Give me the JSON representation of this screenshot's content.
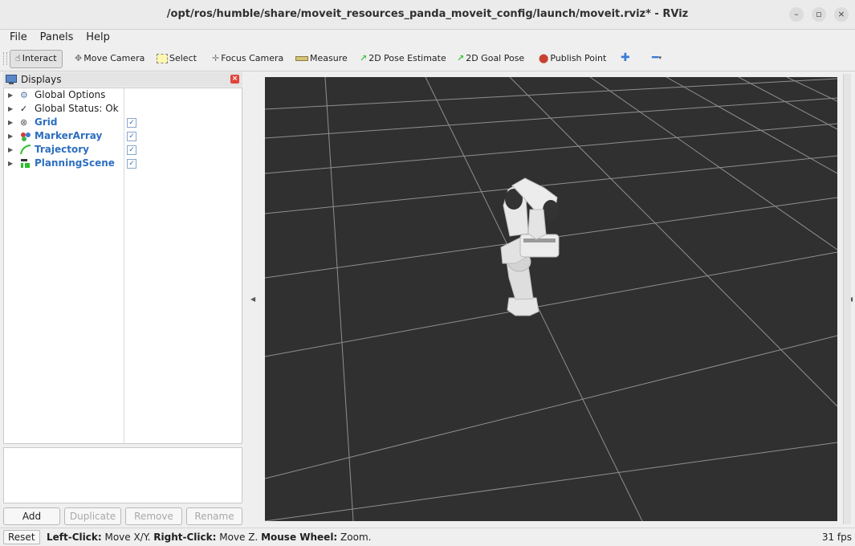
{
  "window": {
    "title": "/opt/ros/humble/share/moveit_resources_panda_moveit_config/launch/moveit.rviz* - RViz",
    "controls": [
      "minimize-icon",
      "maximize-icon",
      "close-icon"
    ]
  },
  "menu": [
    "File",
    "Panels",
    "Help"
  ],
  "toolbar": {
    "interact": "Interact",
    "move_camera": "Move Camera",
    "select": "Select",
    "focus_camera": "Focus Camera",
    "measure": "Measure",
    "pose_estimate": "2D Pose Estimate",
    "goal_pose": "2D Goal Pose",
    "publish_point": "Publish Point",
    "add_tool_icon": "plus-icon",
    "remove_tool_icon": "minus-icon"
  },
  "displays_panel": {
    "title": "Displays",
    "items": [
      {
        "label": "Global Options",
        "icon": "gear-icon",
        "checkbox": false
      },
      {
        "label": "Global Status: Ok",
        "icon": "checkmark-icon",
        "checkbox": false
      },
      {
        "label": "Grid",
        "icon": "grid-icon",
        "checkbox": true,
        "checked": true
      },
      {
        "label": "MarkerArray",
        "icon": "marker-array-icon",
        "checkbox": true,
        "checked": true
      },
      {
        "label": "Trajectory",
        "icon": "trajectory-icon",
        "checkbox": true,
        "checked": true
      },
      {
        "label": "PlanningScene",
        "icon": "planning-scene-icon",
        "checkbox": true,
        "checked": true
      }
    ],
    "buttons": {
      "add": "Add",
      "duplicate": "Duplicate",
      "remove": "Remove",
      "rename": "Rename"
    }
  },
  "colors": {
    "viewport_bg": "#303030",
    "grid_line": "#a0a0a0",
    "robot": "#e6e6e6",
    "display_link": "#2d6fc0"
  },
  "status": {
    "reset": "Reset",
    "hint_parts": [
      {
        "text": "Left-Click:",
        "bold": true
      },
      {
        "text": " Move X/Y. ",
        "bold": false
      },
      {
        "text": "Right-Click:",
        "bold": true
      },
      {
        "text": " Move Z. ",
        "bold": false
      },
      {
        "text": "Mouse Wheel:",
        "bold": true
      },
      {
        "text": " Zoom.",
        "bold": false
      }
    ],
    "fps": "31 fps"
  }
}
